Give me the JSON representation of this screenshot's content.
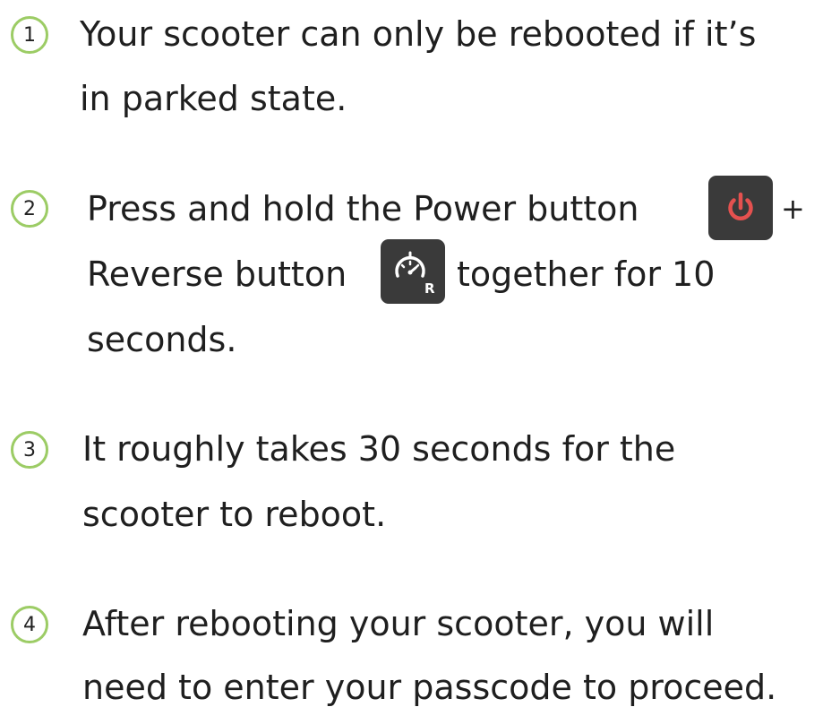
{
  "steps": [
    {
      "number": "1",
      "lines": [
        "Your scooter can only be rebooted if it’s",
        "in parked state."
      ]
    },
    {
      "number": "2",
      "line1_text": "Press and hold the Power button",
      "line1_after": "+",
      "line2_before": "Reverse button",
      "line2_after": "together for 10",
      "line3": "seconds."
    },
    {
      "number": "3",
      "lines": [
        "It roughly takes 30 seconds for the",
        "scooter to reboot."
      ]
    },
    {
      "number": "4",
      "lines": [
        "After rebooting your scooter, you will",
        "need to enter your passcode to proceed."
      ]
    }
  ],
  "icons": {
    "power": "power-icon",
    "reverse": "speedometer-reverse-icon",
    "reverse_letter": "R"
  },
  "colors": {
    "badge_border": "#9ccc65",
    "power_red": "#e5514f",
    "icon_bg": "#3a3a3a"
  }
}
